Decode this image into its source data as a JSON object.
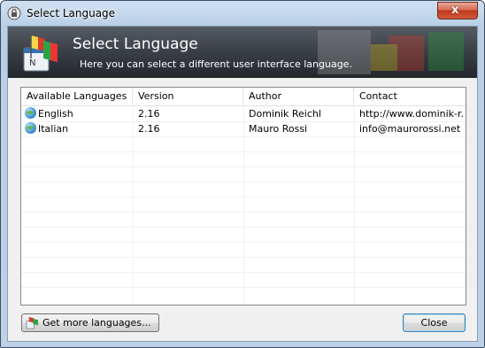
{
  "window": {
    "title": "Select Language",
    "close_glyph": "x"
  },
  "banner": {
    "title": "Select Language",
    "subtitle": "Here you can select a different user interface language.",
    "icon": "flags-notepad-icon"
  },
  "list": {
    "columns": [
      "Available Languages",
      "Version",
      "Author",
      "Contact"
    ],
    "rows": [
      {
        "language": "English",
        "version": "2.16",
        "author": "Dominik Reichl",
        "contact": "http://www.dominik-r..."
      },
      {
        "language": "Italian",
        "version": "2.16",
        "author": "Mauro Rossi",
        "contact": "info@maurorossi.net"
      }
    ]
  },
  "buttons": {
    "more_languages": "Get more languages...",
    "close": "Close"
  },
  "colors": {
    "banner_bg": "#3a3f46",
    "window_frame": "#bcd1e8",
    "close_button": "#c0381c"
  }
}
